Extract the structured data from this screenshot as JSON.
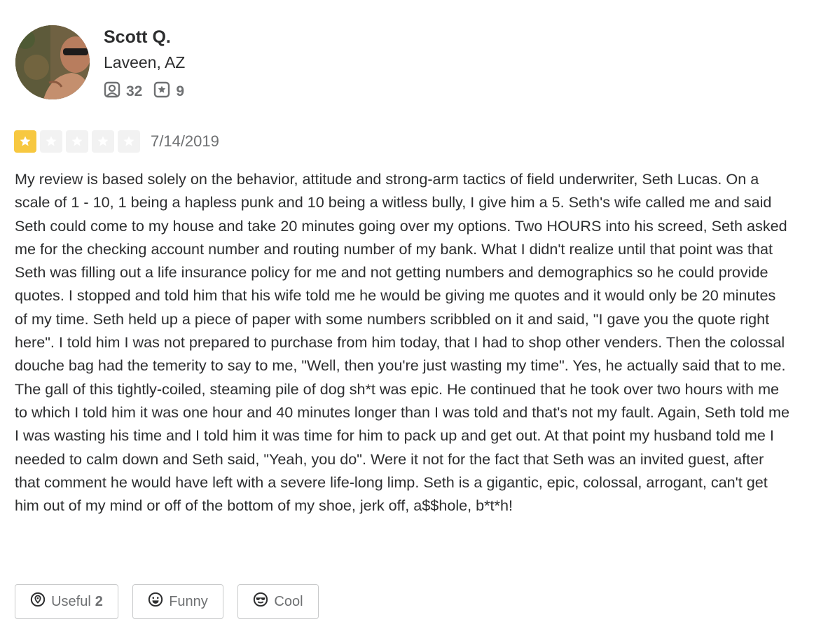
{
  "user": {
    "name": "Scott Q.",
    "location": "Laveen, AZ",
    "friends_count": "32",
    "reviews_count": "9"
  },
  "review": {
    "rating": 1,
    "rating_max": 5,
    "date": "7/14/2019",
    "text": "My review is based solely on the behavior, attitude and strong-arm tactics of field underwriter, Seth Lucas. On a scale of 1 - 10, 1 being a hapless punk and 10 being a witless bully, I give him a 5. Seth's wife called me and said Seth could come to my house and take 20 minutes going over my options. Two HOURS into his screed, Seth asked me for the checking account number and routing number of my bank. What I didn't realize until that point was that Seth was filling out a life insurance policy for me and not getting numbers and demographics so he could provide quotes. I stopped and told him that his wife told me he would be giving me quotes and it would only be 20 minutes of my time. Seth held up a piece of paper with some numbers scribbled on it and said, \"I gave you the quote right here\". I told him I was not prepared to purchase from him today, that I had to shop other venders. Then the colossal douche bag had the temerity to say to me, \"Well, then you're just wasting my time\". Yes, he actually said that to me. The gall of this tightly-coiled, steaming pile of dog sh*t was epic. He continued that he took over two hours with me to which I told him it was one hour and 40 minutes longer than I was told and that's not my fault. Again, Seth told me I was wasting his time and I told him it was time for him to pack up and get out. At that point my husband told me I needed to calm down and Seth said, \"Yeah, you do\". Were it not for the fact that Seth was an invited guest, after that comment he would have left with a severe life-long limp. Seth is a gigantic, epic, colossal, arrogant, can't get him out of my mind or off of the bottom of my shoe, jerk off, a$$hole, b*t*h!"
  },
  "reactions": {
    "useful_label": "Useful",
    "useful_count": "2",
    "funny_label": "Funny",
    "cool_label": "Cool"
  },
  "colors": {
    "star_filled": "#f7c840",
    "star_empty": "#f2f2f2",
    "text": "#2d2e2f",
    "muted": "#6e7072"
  },
  "icons": {
    "friends": "friends-icon",
    "reviews": "review-star-icon",
    "useful": "useful-icon",
    "funny": "funny-icon",
    "cool": "cool-icon"
  }
}
